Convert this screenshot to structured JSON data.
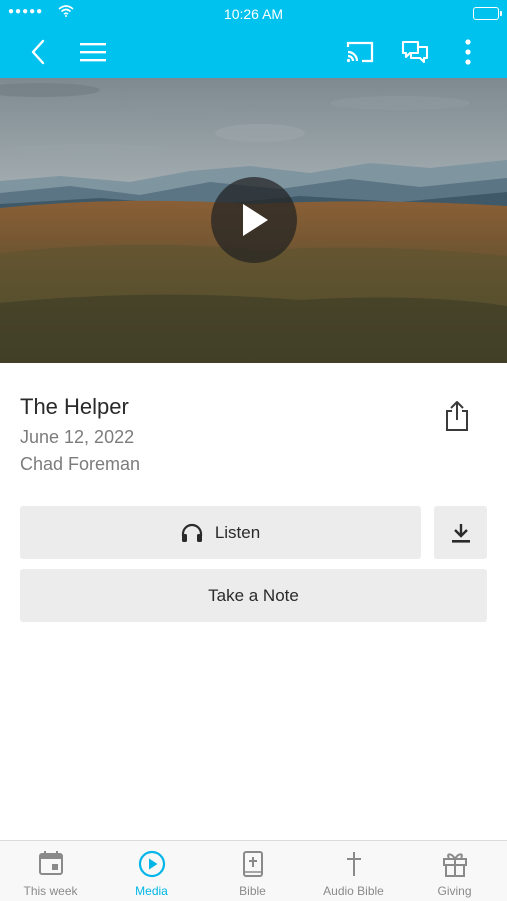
{
  "status_bar": {
    "time": "10:26 AM"
  },
  "colors": {
    "accent": "#00c2ee",
    "button_bg": "#ececed",
    "tab_active": "#00b6e6",
    "tab_inactive": "#8a8a8a"
  },
  "header": {
    "icons": [
      "back-icon",
      "menu-icon",
      "cast-icon",
      "chat-icon",
      "more-icon"
    ]
  },
  "media": {
    "title": "The Helper",
    "date": "June 12, 2022",
    "speaker": "Chad Foreman",
    "listen_label": "Listen",
    "note_label": "Take a Note"
  },
  "tabs": [
    {
      "label": "This week",
      "icon": "calendar-icon"
    },
    {
      "label": "Media",
      "icon": "play-circle-icon",
      "active": true
    },
    {
      "label": "Bible",
      "icon": "bible-icon"
    },
    {
      "label": "Audio Bible",
      "icon": "cross-icon"
    },
    {
      "label": "Giving",
      "icon": "gift-icon"
    }
  ]
}
